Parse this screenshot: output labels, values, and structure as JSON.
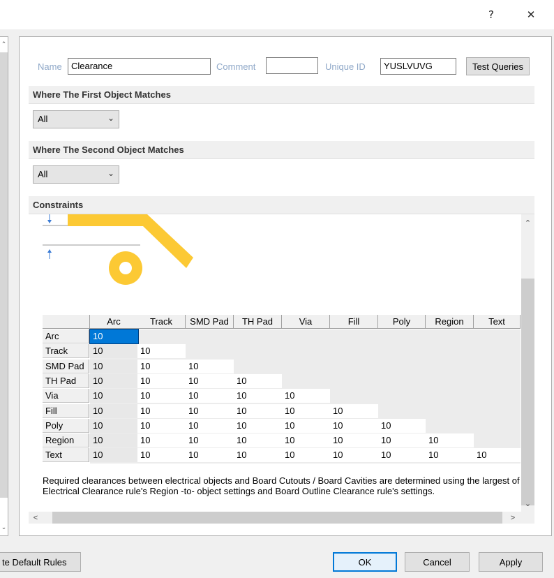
{
  "titlebar": {
    "help": "?",
    "close": "✕"
  },
  "fields": {
    "name_label": "Name",
    "name_value": "Clearance",
    "comment_label": "Comment",
    "comment_value": "",
    "uid_label": "Unique ID",
    "uid_value": "YUSLVUVG",
    "test_queries": "Test Queries"
  },
  "first_match": {
    "title": "Where The First Object Matches",
    "value": "All"
  },
  "second_match": {
    "title": "Where The Second Object Matches",
    "value": "All"
  },
  "constraints": {
    "title": "Constraints",
    "columns": [
      "Arc",
      "Track",
      "SMD Pad",
      "TH Pad",
      "Via",
      "Fill",
      "Poly",
      "Region",
      "Text"
    ],
    "rows": [
      {
        "label": "Arc",
        "values": [
          "10"
        ]
      },
      {
        "label": "Track",
        "values": [
          "10",
          "10"
        ]
      },
      {
        "label": "SMD Pad",
        "values": [
          "10",
          "10",
          "10"
        ]
      },
      {
        "label": "TH Pad",
        "values": [
          "10",
          "10",
          "10",
          "10"
        ]
      },
      {
        "label": "Via",
        "values": [
          "10",
          "10",
          "10",
          "10",
          "10"
        ]
      },
      {
        "label": "Fill",
        "values": [
          "10",
          "10",
          "10",
          "10",
          "10",
          "10"
        ]
      },
      {
        "label": "Poly",
        "values": [
          "10",
          "10",
          "10",
          "10",
          "10",
          "10",
          "10"
        ]
      },
      {
        "label": "Region",
        "values": [
          "10",
          "10",
          "10",
          "10",
          "10",
          "10",
          "10",
          "10"
        ]
      },
      {
        "label": "Text",
        "values": [
          "10",
          "10",
          "10",
          "10",
          "10",
          "10",
          "10",
          "10",
          "10"
        ]
      }
    ],
    "note": "Required clearances between electrical objects and Board Cutouts / Board Cavities are determined using the largest of Electrical Clearance rule's Region -to- object settings and Board Outline Clearance rule's settings.",
    "colors": {
      "copper": "#fcc934",
      "selected": "#0078d7"
    }
  },
  "footer": {
    "create_default": "te Default Rules",
    "ok": "OK",
    "cancel": "Cancel",
    "apply": "Apply"
  }
}
